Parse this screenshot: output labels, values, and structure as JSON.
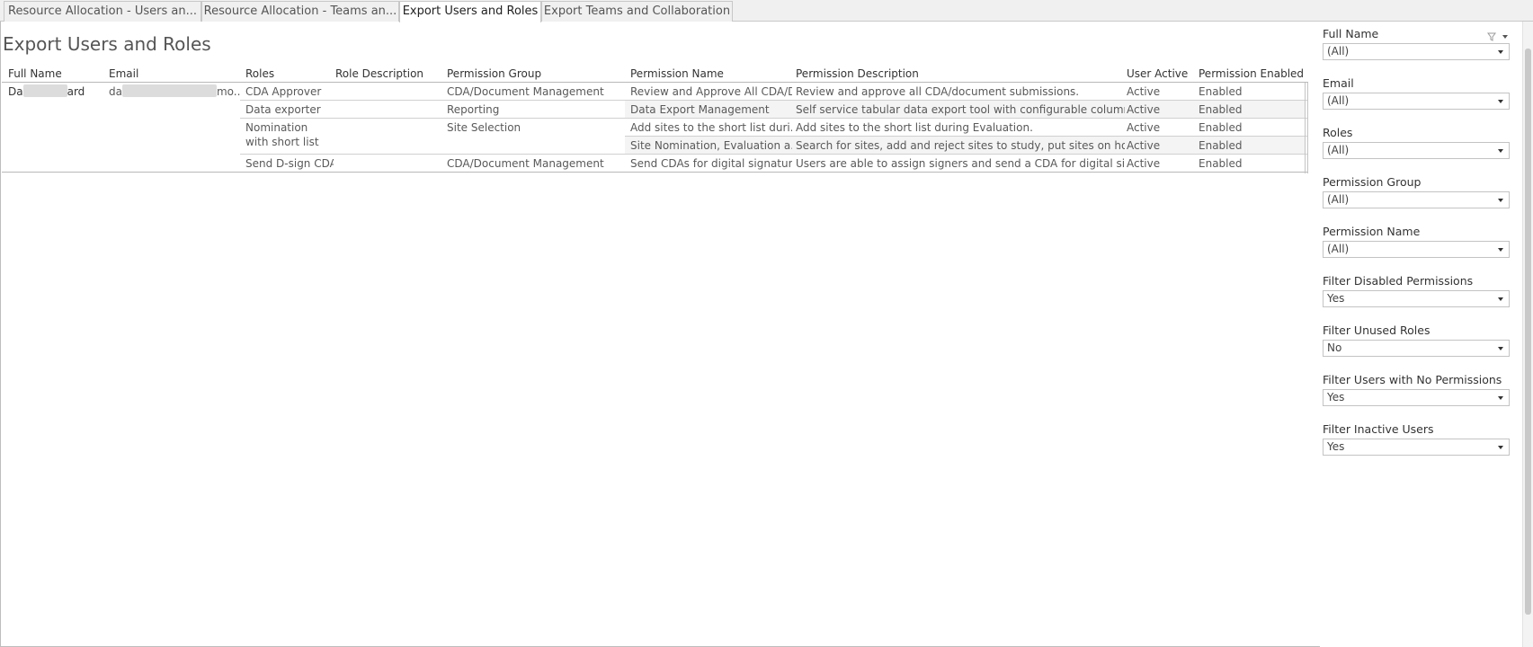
{
  "tabs": [
    {
      "label": "Resource Allocation - Users an...",
      "active": false
    },
    {
      "label": "Resource Allocation - Teams an...",
      "active": false
    },
    {
      "label": "Export Users and Roles",
      "active": true
    },
    {
      "label": "Export Teams and Collaboration",
      "active": false
    }
  ],
  "page_title": "Export Users and Roles",
  "table": {
    "headers": {
      "full_name": "Full Name",
      "email": "Email",
      "roles": "Roles",
      "role_description": "Role Description",
      "permission_group": "Permission Group",
      "permission_name": "Permission Name",
      "permission_description": "Permission Description",
      "user_active": "User Active",
      "permission_enabled": "Permission Enabled"
    },
    "user": {
      "name_prefix": "Da",
      "name_suffix": "ard",
      "email_prefix": "da",
      "email_suffix": "mo.."
    },
    "roles": [
      {
        "role": "CDA Approver",
        "group": "CDA/Document Management"
      },
      {
        "role": "Data exporter",
        "group": "Reporting"
      },
      {
        "role": "Nomination with short list",
        "group": "Site Selection"
      },
      {
        "role": "Send D-sign CDA",
        "group": "CDA/Document Management"
      }
    ],
    "rows": [
      {
        "permission_name": "Review and Approve All CDA/D..",
        "permission_description": "Review and approve all CDA/document submissions.",
        "user_active": "Active",
        "permission_enabled": "Enabled"
      },
      {
        "permission_name": "Data Export Management",
        "permission_description": "Self service tabular data export tool with configurable columns..",
        "user_active": "Active",
        "permission_enabled": "Enabled"
      },
      {
        "permission_name": "Add sites to the short list duri..",
        "permission_description": "Add sites to the short list during Evaluation.",
        "user_active": "Active",
        "permission_enabled": "Enabled"
      },
      {
        "permission_name": "Site Nomination, Evaluation a..",
        "permission_description": "Search for sites, add and reject sites to study, put sites on hold.",
        "user_active": "Active",
        "permission_enabled": "Enabled"
      },
      {
        "permission_name": "Send CDAs for digital signature",
        "permission_description": "Users are able to assign signers and send a CDA for digital sign..",
        "user_active": "Active",
        "permission_enabled": "Enabled"
      }
    ]
  },
  "filters": [
    {
      "title": "Full Name",
      "value": "(All)"
    },
    {
      "title": "Email",
      "value": "(All)"
    },
    {
      "title": "Roles",
      "value": "(All)"
    },
    {
      "title": "Permission Group",
      "value": "(All)"
    },
    {
      "title": "Permission Name",
      "value": "(All)"
    },
    {
      "title": "Filter Disabled Permissions",
      "value": "Yes"
    },
    {
      "title": "Filter Unused Roles",
      "value": "No"
    },
    {
      "title": "Filter Users with No Permissions",
      "value": "Yes"
    },
    {
      "title": "Filter Inactive Users",
      "value": "Yes"
    }
  ],
  "icons": {
    "filter_funnel": "funnel-icon",
    "dropdown": "chevron-down-icon"
  }
}
